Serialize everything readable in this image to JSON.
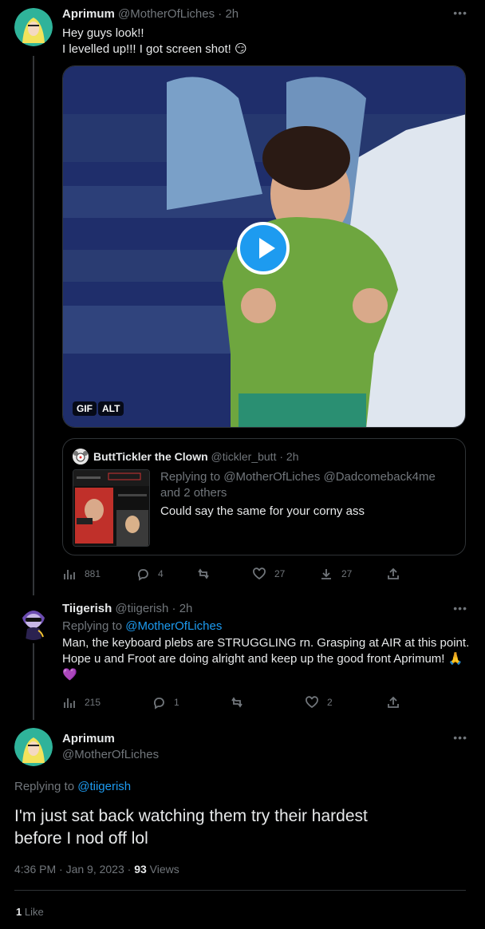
{
  "tweet1": {
    "display_name": "Aprimum",
    "handle": "@MotherOfLiches",
    "time": "2h",
    "line1": "Hey guys look!!",
    "line2": "I levelled up!!! I got screen shot! 😏",
    "media_badges": [
      "GIF",
      "ALT"
    ],
    "quote": {
      "display_name": "ButtTickler the Clown",
      "handle": "@tickler_butt",
      "time": "2h",
      "reply_prefix": "Replying to ",
      "reply_targets": "@MotherOfLiches @Dadcomeback4me",
      "reply_others": "and 2 others",
      "text": "Could say the same for your corny ass"
    },
    "stats": {
      "views": "881",
      "replies": "4",
      "retweets": "",
      "likes": "27",
      "downloads": "27"
    }
  },
  "tweet2": {
    "display_name": "Tiigerish",
    "handle": "@tiigerish",
    "time": "2h",
    "reply_prefix": "Replying to ",
    "reply_target": "@MotherOfLiches",
    "line1": "Man, the keyboard plebs are STRUGGLING rn. Grasping at AIR at this point.",
    "line2": "Hope u and Froot are doing alright and keep up the good front Aprimum! 🙏",
    "line3": "💜",
    "stats": {
      "views": "215",
      "replies": "1",
      "retweets": "",
      "likes": "2"
    }
  },
  "main": {
    "display_name": "Aprimum",
    "handle": "@MotherOfLiches",
    "reply_prefix": "Replying to ",
    "reply_target": "@tiigerish",
    "line1": "I'm just sat back watching them try their hardest",
    "line2": "before I nod off lol",
    "timestamp": "4:36 PM · Jan 9, 2023 · ",
    "views_count": "93",
    "views_label": " Views",
    "likes_count": "1",
    "likes_label": " Like"
  },
  "colors": {
    "background": "#000000",
    "text": "#e7e9ea",
    "muted": "#71767b",
    "accent": "#1d9bf0",
    "border": "#2f3336"
  },
  "icons": [
    "more-icon",
    "views-icon",
    "reply-icon",
    "retweet-icon",
    "like-icon",
    "download-icon",
    "share-icon",
    "play-icon"
  ]
}
